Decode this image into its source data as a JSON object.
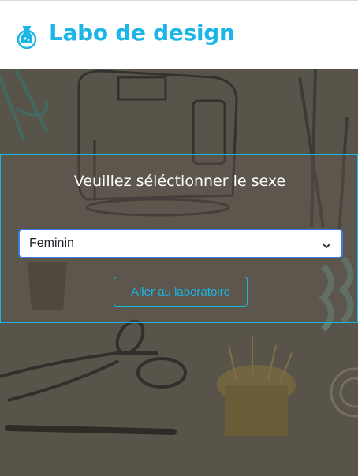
{
  "header": {
    "brand": "Labo de design",
    "logo_icon": "flask-icon"
  },
  "panel": {
    "prompt": "Veuillez séléctionner le sexe",
    "select": {
      "value": "Feminin"
    },
    "button_label": "Aller au laboratoire"
  },
  "colors": {
    "accent": "#1bb6e6",
    "background": "#59544a",
    "select_focus": "#3d7be0"
  }
}
